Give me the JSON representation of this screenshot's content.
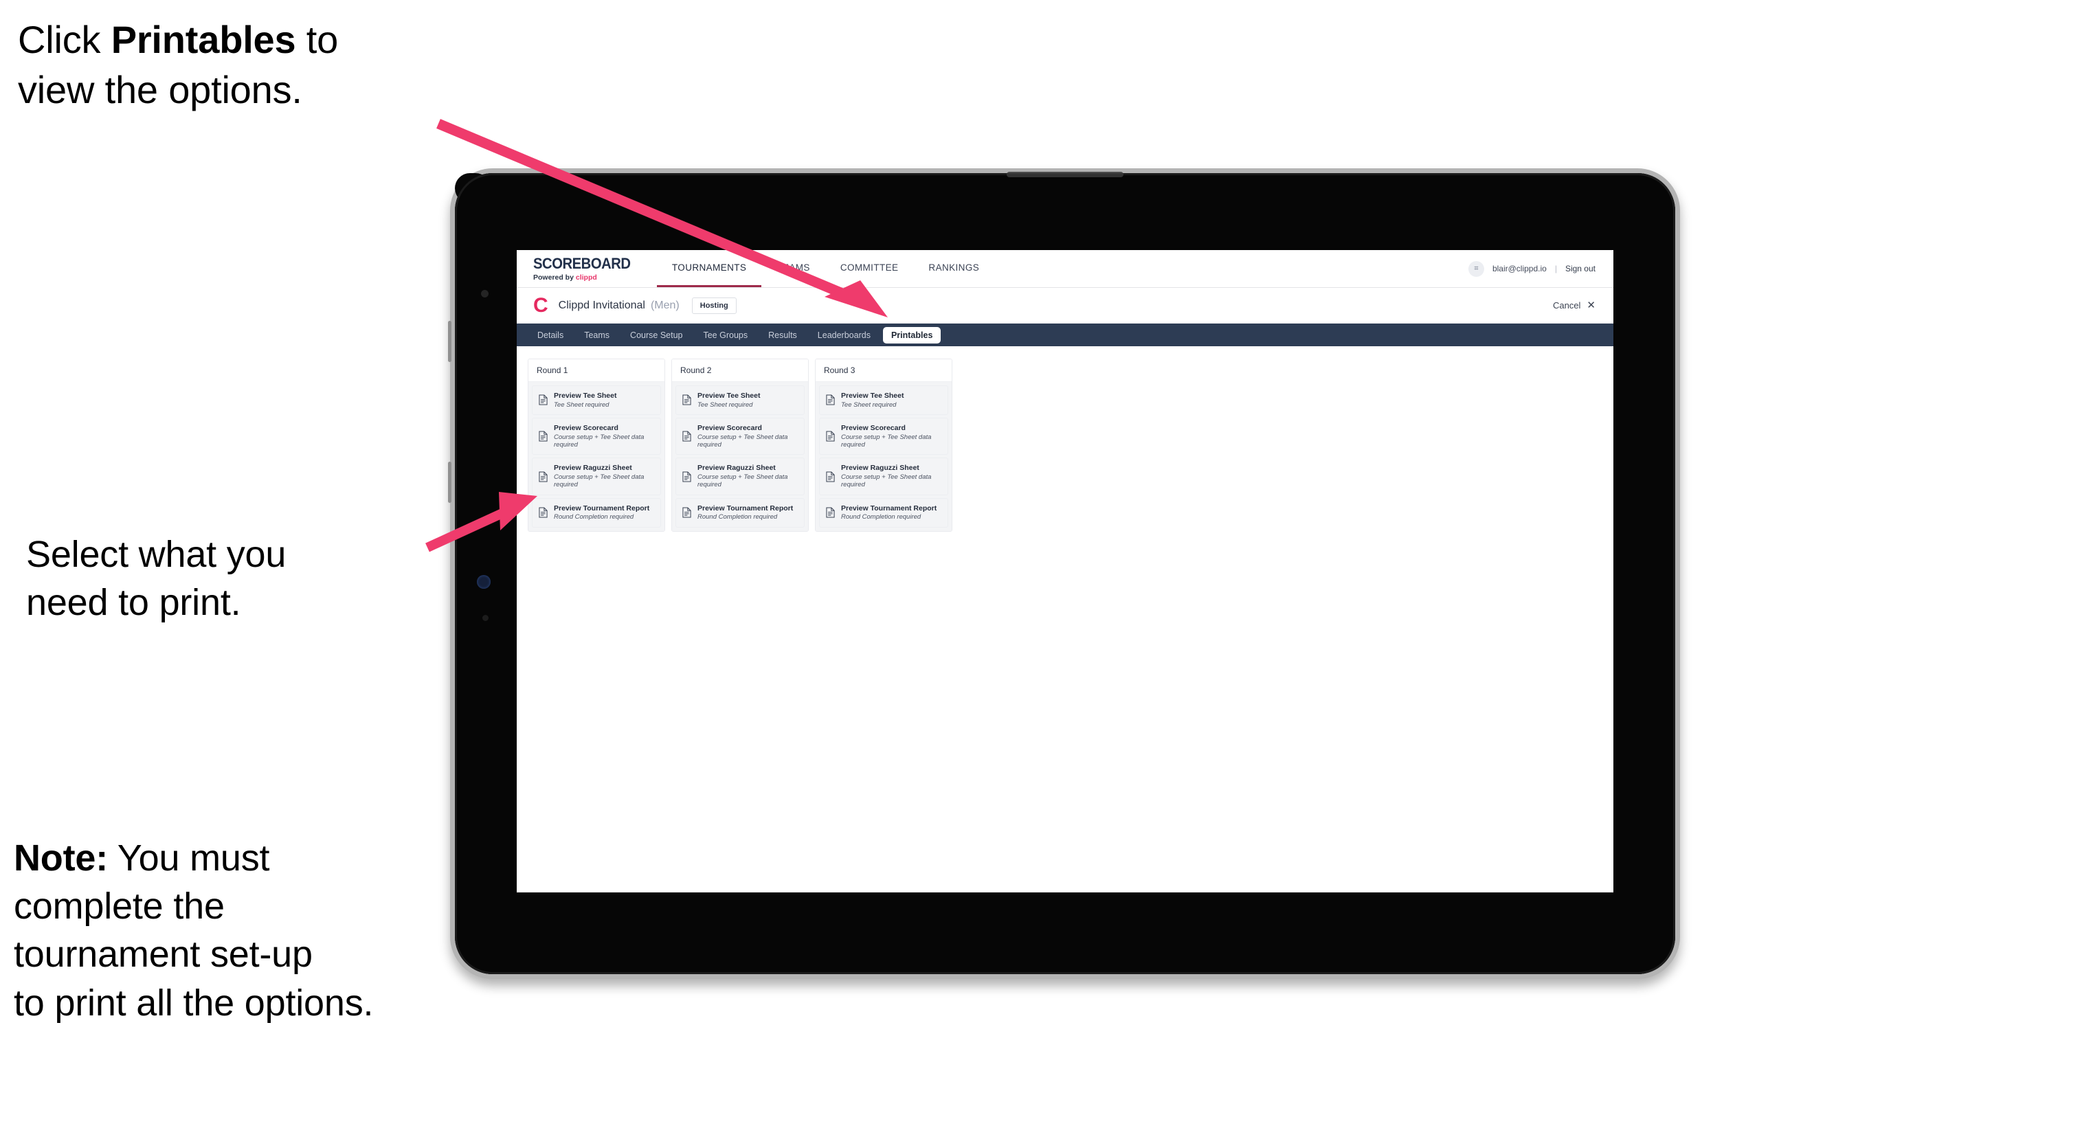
{
  "annotations": {
    "click_printables": "Click Printables to view the options.",
    "click_printables_pre": "Click ",
    "click_printables_bold": "Printables",
    "click_printables_post": " to\nview the options.",
    "select_print": "Select what you\n need to print.",
    "note_bold": "Note:",
    "note_rest": " You must\ncomplete the\ntournament set-up\nto print all the options."
  },
  "browser": {
    "brand": {
      "title": "SCOREBOARD",
      "sub_prefix": "Powered by ",
      "sub_brand": "clippd"
    },
    "topnav": [
      {
        "label": "TOURNAMENTS",
        "active": true
      },
      {
        "label": "TEAMS",
        "active": false
      },
      {
        "label": "COMMITTEE",
        "active": false
      },
      {
        "label": "RANKINGS",
        "active": false
      }
    ],
    "account": {
      "avatar_glyph": "⌗",
      "email": "blair@clippd.io",
      "separator": "|",
      "signout": "Sign out"
    },
    "subheader": {
      "logo_letter": "C",
      "tournament_name": "Clippd Invitational",
      "gender": "(Men)",
      "badge": "Hosting",
      "cancel_label": "Cancel",
      "cancel_icon": "✕"
    },
    "tabs": [
      {
        "label": "Details",
        "active": false
      },
      {
        "label": "Teams",
        "active": false
      },
      {
        "label": "Course Setup",
        "active": false
      },
      {
        "label": "Tee Groups",
        "active": false
      },
      {
        "label": "Results",
        "active": false
      },
      {
        "label": "Leaderboards",
        "active": false
      },
      {
        "label": "Printables",
        "active": true
      }
    ],
    "rounds": [
      {
        "title": "Round 1",
        "items": [
          {
            "title": "Preview Tee Sheet",
            "sub": "Tee Sheet required"
          },
          {
            "title": "Preview Scorecard",
            "sub": "Course setup + Tee Sheet data required"
          },
          {
            "title": "Preview Raguzzi Sheet",
            "sub": "Course setup + Tee Sheet data required"
          },
          {
            "title": "Preview Tournament Report",
            "sub": "Round Completion required"
          }
        ]
      },
      {
        "title": "Round 2",
        "items": [
          {
            "title": "Preview Tee Sheet",
            "sub": "Tee Sheet required"
          },
          {
            "title": "Preview Scorecard",
            "sub": "Course setup + Tee Sheet data required"
          },
          {
            "title": "Preview Raguzzi Sheet",
            "sub": "Course setup + Tee Sheet data required"
          },
          {
            "title": "Preview Tournament Report",
            "sub": "Round Completion required"
          }
        ]
      },
      {
        "title": "Round 3",
        "items": [
          {
            "title": "Preview Tee Sheet",
            "sub": "Tee Sheet required"
          },
          {
            "title": "Preview Scorecard",
            "sub": "Course setup + Tee Sheet data required"
          },
          {
            "title": "Preview Raguzzi Sheet",
            "sub": "Course setup + Tee Sheet data required"
          },
          {
            "title": "Preview Tournament Report",
            "sub": "Round Completion required"
          }
        ]
      }
    ]
  },
  "colors": {
    "accent_pink": "#ef3b6c",
    "brand_pink": "#e5295f",
    "tabstrip_dark": "#2d3c54",
    "nav_active_underline": "#9e2a4a",
    "card_bg": "#f3f4f6"
  }
}
